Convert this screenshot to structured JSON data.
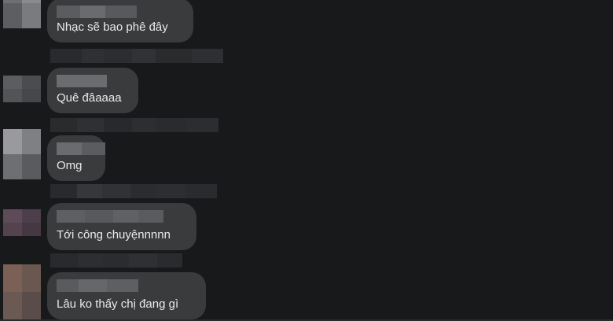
{
  "comments": [
    {
      "text": "Nhạc sẽ bao phê đây"
    },
    {
      "text": "Quê đâaaaa"
    },
    {
      "text": "Omg"
    },
    {
      "text": "Tới công chuyệnnnnn"
    },
    {
      "text": "Lâu ko thấy chị đang gì"
    }
  ],
  "colors": {
    "background": "#18191b",
    "bubble": "#3a3b3d",
    "text": "#e9eaec"
  }
}
